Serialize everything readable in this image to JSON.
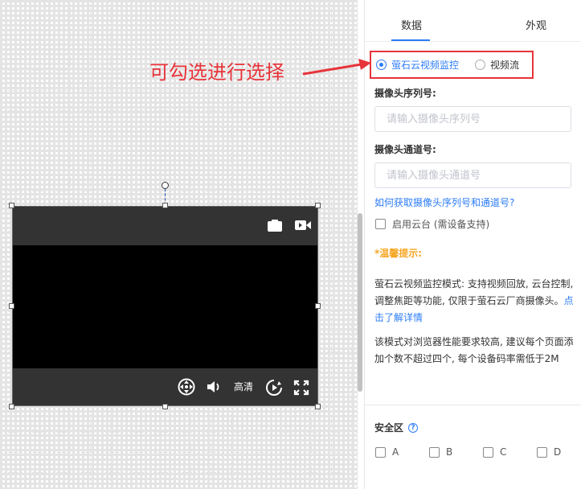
{
  "annotation": {
    "text": "可勾选进行选择",
    "color": "#e7343a"
  },
  "tabs": [
    {
      "label": "数据",
      "active": true
    },
    {
      "label": "外观",
      "active": false
    }
  ],
  "source_options": [
    {
      "label": "萤石云视频监控",
      "checked": true
    },
    {
      "label": "视频流",
      "checked": false
    }
  ],
  "serial": {
    "label": "摄像头序列号:",
    "placeholder": "请输入摄像头序列号",
    "value": ""
  },
  "channel": {
    "label": "摄像头通道号:",
    "placeholder": "请输入摄像头通道号",
    "value": ""
  },
  "help_link": "如何获取摄像头序列号和通道号?",
  "ptz": {
    "label": "启用云台 (需设备支持)",
    "checked": false
  },
  "tip": {
    "title": "*温馨提示:",
    "para1": "萤石云视频监控模式: 支持视频回放, 云台控制, 调整焦距等功能, 仅限于萤石云厂商摄像头。",
    "para1_link": "点击了解详情",
    "para2": "该模式对浏览器性能要求较高, 建议每个页面添加个数不超过四个, 每个设备码率需低于2M"
  },
  "safe_zone": {
    "label": "安全区",
    "options": [
      "A",
      "B",
      "C",
      "D"
    ]
  },
  "video": {
    "quality_label": "高清",
    "top_icons": [
      "camera-icon",
      "video-record-icon"
    ],
    "bottom_icons": [
      "ptz-control-icon",
      "volume-icon",
      "playback-icon",
      "fullscreen-icon"
    ]
  },
  "colors": {
    "accent": "#2c7cf6",
    "warning": "#f5a623",
    "annotation": "#e7343a",
    "video_bar": "#333333"
  }
}
